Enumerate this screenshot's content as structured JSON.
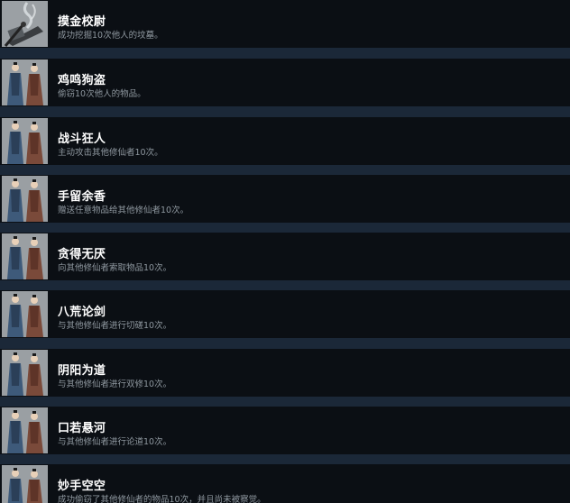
{
  "achievements": [
    {
      "title": "摸金校尉",
      "desc": "成功挖掘10次他人的坟墓。",
      "icon": "tomb-digging-icon"
    },
    {
      "title": "鸡鸣狗盗",
      "desc": "偷窃10次他人的物品。",
      "icon": "two-cultivators-icon"
    },
    {
      "title": "战斗狂人",
      "desc": "主动攻击其他修仙者10次。",
      "icon": "two-cultivators-icon"
    },
    {
      "title": "手留余香",
      "desc": "赠送任意物品给其他修仙者10次。",
      "icon": "two-cultivators-icon"
    },
    {
      "title": "贪得无厌",
      "desc": "向其他修仙者索取物品10次。",
      "icon": "two-cultivators-icon"
    },
    {
      "title": "八荒论剑",
      "desc": "与其他修仙者进行切磋10次。",
      "icon": "two-cultivators-icon"
    },
    {
      "title": "阴阳为道",
      "desc": "与其他修仙者进行双修10次。",
      "icon": "two-cultivators-icon"
    },
    {
      "title": "口若悬河",
      "desc": "与其他修仙者进行论道10次。",
      "icon": "two-cultivators-icon"
    },
    {
      "title": "妙手空空",
      "desc": "成功偷窃了其他修仙者的物品10次，并且尚未被察觉。",
      "icon": "two-cultivators-icon"
    }
  ],
  "colors": {
    "row_bg": "#0b0f14",
    "gap_bg": "#1b2838",
    "title": "#ffffff",
    "desc": "#8f98a0"
  }
}
